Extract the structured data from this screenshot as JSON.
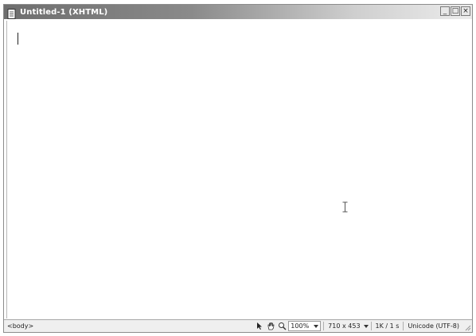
{
  "window": {
    "title": "Untitled-1 (XHTML)",
    "controls": {
      "minimize": "_",
      "restore": "□",
      "close": "×"
    }
  },
  "statusbar": {
    "tag_selector": "<body>",
    "zoom": "100%",
    "window_size": "710 x 453",
    "download_stats": "1K / 1 s",
    "encoding": "Unicode (UTF-8)"
  },
  "icons": {
    "document": "document-icon",
    "select_tool": "pointer-tool-icon",
    "hand_tool": "hand-tool-icon",
    "zoom_tool": "zoom-tool-icon"
  }
}
